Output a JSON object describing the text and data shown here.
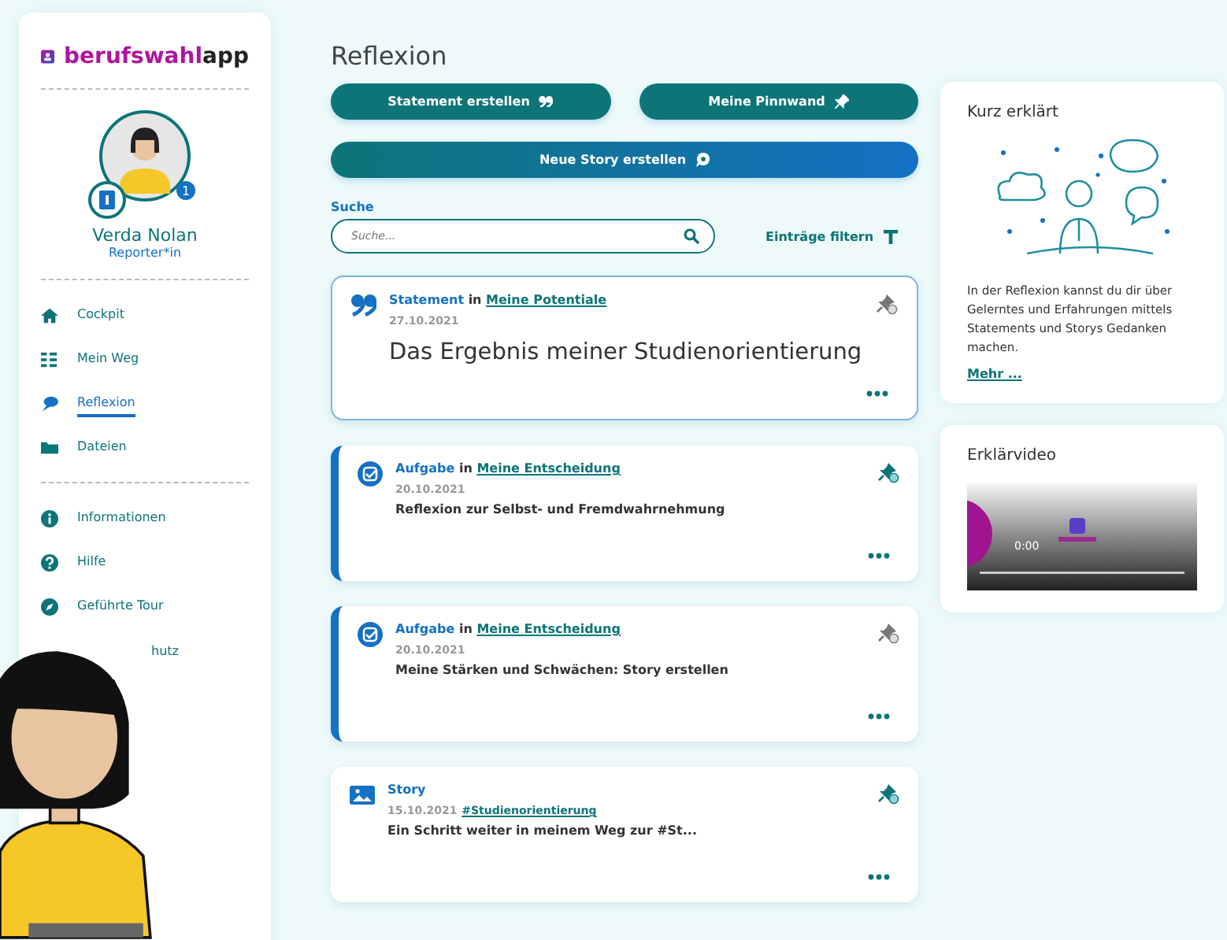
{
  "brand": {
    "part1": "berufswahl",
    "part2": "app"
  },
  "profile": {
    "name": "Verda Nolan",
    "role": "Reporter*in",
    "badge_count": "1"
  },
  "nav_main": [
    {
      "label": "Cockpit",
      "selected": false
    },
    {
      "label": "Mein Weg",
      "selected": false
    },
    {
      "label": "Reflexion",
      "selected": true
    },
    {
      "label": "Dateien",
      "selected": false
    }
  ],
  "nav_info": [
    {
      "label": "Informationen"
    },
    {
      "label": "Hilfe"
    },
    {
      "label": "Geführte Tour"
    },
    {
      "label": "hutz"
    }
  ],
  "page_title": "Reflexion",
  "actions": [
    {
      "label": "Statement erstellen"
    },
    {
      "label": "Meine Pinnwand"
    },
    {
      "label": "Neue Story erstellen"
    }
  ],
  "search": {
    "label": "Suche",
    "placeholder": "Suche..."
  },
  "filter": "Einträge filtern",
  "entries": [
    {
      "kind": "statement",
      "type": "Statement",
      "in": "in",
      "topic": "Meine Potentiale",
      "date": "27.10.2021",
      "title": "Das Ergebnis meiner Studienorientierung",
      "pinned": false
    },
    {
      "kind": "task",
      "type": "Aufgabe",
      "in": "in",
      "topic": "Meine Entscheidung",
      "date": "20.10.2021",
      "title": "Reflexion zur Selbst- und Fremdwahrnehmung",
      "pinned": true
    },
    {
      "kind": "task",
      "type": "Aufgabe",
      "in": "in",
      "topic": "Meine Entscheidung",
      "date": "20.10.2021",
      "title": "Meine Stärken und Schwächen: Story erstellen",
      "pinned": false
    },
    {
      "kind": "story",
      "type": "Story",
      "date": "15.10.2021",
      "tag": "#Studienorientierung",
      "title": "Ein Schritt weiter in meinem Weg zur #St...",
      "pinned": true
    }
  ],
  "info_card": {
    "title": "Kurz erklärt",
    "text": "In der Reflexion kannst du dir über Gelerntes und Erfahrungen mittels Statements und Storys Gedanken machen.",
    "link": "Mehr ..."
  },
  "video_card": {
    "title": "Erklärvideo",
    "time": "0:00"
  }
}
